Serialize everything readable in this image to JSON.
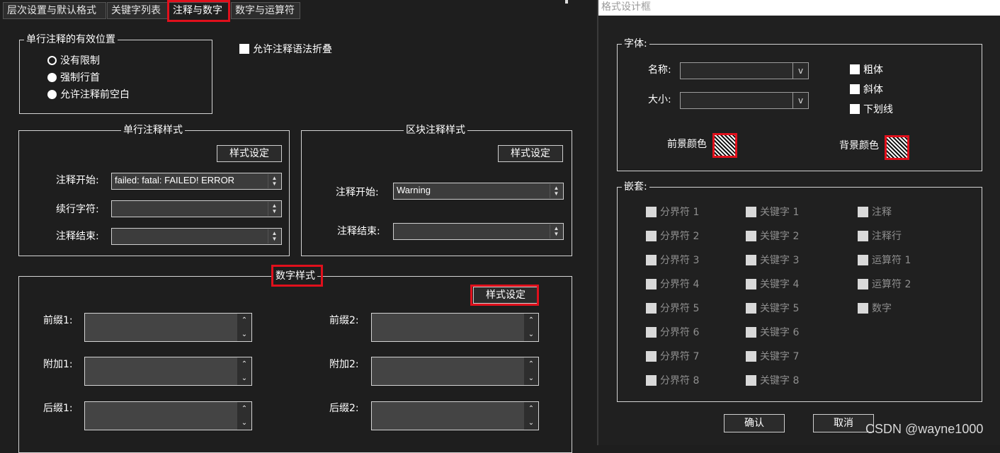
{
  "tabs": [
    "层次设置与默认格式",
    "关键字列表",
    "注释与数字",
    "数字与运算符"
  ],
  "single_comment_position": {
    "title": "单行注释的有效位置",
    "options": [
      "没有限制",
      "强制行首",
      "允许注释前空白"
    ]
  },
  "allow_fold_label": "允许注释语法折叠",
  "single_comment_style": {
    "title": "单行注释样式",
    "style_button": "样式设定",
    "start_label": "注释开始:",
    "start_value": "failed: fatal: FAILED! ERROR",
    "continue_label": "续行字符:",
    "continue_value": "",
    "end_label": "注释结束:",
    "end_value": ""
  },
  "block_comment_style": {
    "title": "区块注释样式",
    "style_button": "样式设定",
    "start_label": "注释开始:",
    "start_value": "Warning",
    "end_label": "注释结束:",
    "end_value": ""
  },
  "number_style": {
    "title": "数字样式",
    "style_button": "样式设定",
    "prefix1": "前缀1:",
    "extra1": "附加1:",
    "suffix1": "后缀1:",
    "prefix2": "前缀2:",
    "extra2": "附加2:",
    "suffix2": "后缀2:"
  },
  "dialog": {
    "title": "格式设计框",
    "font_group": "字体:",
    "name_label": "名称:",
    "size_label": "大小:",
    "combo_arrow": "v",
    "bold": "粗体",
    "italic": "斜体",
    "underline": "下划线",
    "fg_color": "前景颜色",
    "bg_color": "背景颜色",
    "nesting_group": "嵌套:",
    "col1": [
      "分界符 1",
      "分界符 2",
      "分界符 3",
      "分界符 4",
      "分界符 5",
      "分界符 6",
      "分界符 7",
      "分界符 8"
    ],
    "col2": [
      "关键字 1",
      "关键字 2",
      "关键字 3",
      "关键字 4",
      "关键字 5",
      "关键字 6",
      "关键字 7",
      "关键字 8"
    ],
    "col3": [
      "注释",
      "注释行",
      "运算符 1",
      "运算符 2",
      "数字"
    ],
    "ok": "确认",
    "cancel": "取消"
  },
  "watermark": "CSDN @wayne1000"
}
